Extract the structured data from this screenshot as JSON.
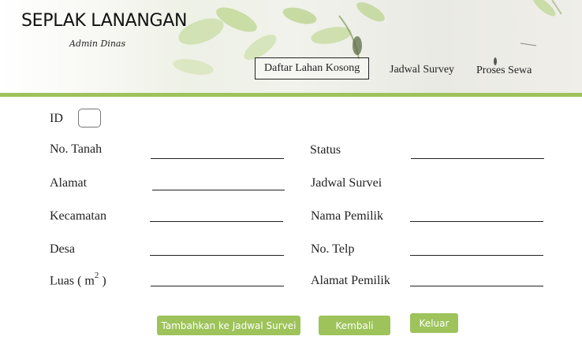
{
  "header": {
    "brand": "SEPLAK LANANGAN",
    "subtitle": "Admin Dinas",
    "nav": [
      {
        "label": "Daftar Lahan Kosong",
        "active": true
      },
      {
        "label": "Jadwal Survey",
        "active": false
      },
      {
        "label": "Proses Sewa",
        "active": false
      }
    ]
  },
  "form": {
    "id_label": "ID",
    "left_fields": [
      {
        "label": "No. Tanah"
      },
      {
        "label": "Alamat"
      },
      {
        "label": "Kecamatan"
      },
      {
        "label": "Desa"
      },
      {
        "label": "Luas ( m",
        "unit_sup": "2",
        "suffix": " )"
      }
    ],
    "right_fields": [
      {
        "label": "Status"
      },
      {
        "label": "Jadwal Survei"
      },
      {
        "label": "Nama Pemilik"
      },
      {
        "label": "No. Telp"
      },
      {
        "label": "Alamat Pemilik"
      }
    ]
  },
  "buttons": {
    "add_survey": "Tambahkan ke Jadwal Survei",
    "back": "Kembali",
    "logout": "Keluar"
  },
  "colors": {
    "accent_green": "#9dc35a"
  }
}
